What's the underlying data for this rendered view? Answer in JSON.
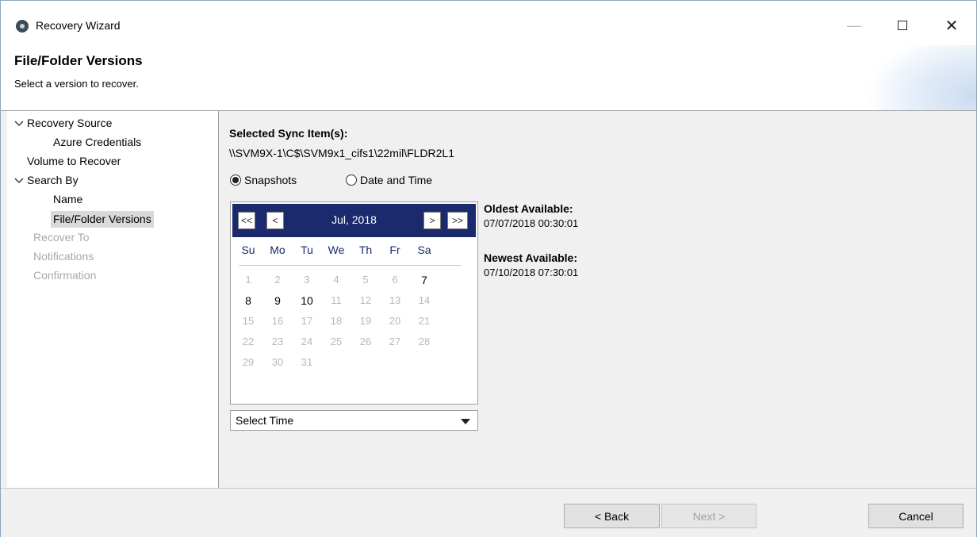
{
  "window": {
    "title": "Recovery Wizard",
    "close_glyph": "✕",
    "minimize_glyph": "—"
  },
  "header": {
    "title": "File/Folder Versions",
    "subtitle": "Select a version to recover."
  },
  "nav": {
    "items": [
      {
        "label": "Recovery Source",
        "state": "normal",
        "expandable": true
      },
      {
        "label": "Azure Credentials",
        "state": "normal"
      },
      {
        "label": "Volume to Recover",
        "state": "normal"
      },
      {
        "label": "Search By",
        "state": "normal",
        "expandable": true
      },
      {
        "label": "Name",
        "state": "normal"
      },
      {
        "label": "File/Folder Versions",
        "state": "selected"
      },
      {
        "label": "Recover To",
        "state": "disabled"
      },
      {
        "label": "Notifications",
        "state": "disabled"
      },
      {
        "label": "Confirmation",
        "state": "disabled"
      }
    ],
    "expand_glyph": "✓"
  },
  "content": {
    "selected_label": "Selected Sync Item(s):",
    "selected_path": "\\\\SVM9X-1\\C$\\SVM9x1_cifs1\\22mil\\FLDR2L1",
    "mode_options": [
      {
        "label": "Snapshots",
        "checked": true
      },
      {
        "label": "Date and Time",
        "checked": false
      }
    ],
    "calendar": {
      "month": "Jul, 2018",
      "nav": {
        "first": "<<",
        "prev": "<",
        "next": ">",
        "last": ">>"
      },
      "weekdays": [
        "Su",
        "Mo",
        "Tu",
        "We",
        "Th",
        "Fr",
        "Sa"
      ],
      "weeks": [
        [
          "1",
          "2",
          "3",
          "4",
          "5",
          "6",
          "7"
        ],
        [
          "8",
          "9",
          "10",
          "11",
          "12",
          "13",
          "14"
        ],
        [
          "15",
          "16",
          "17",
          "18",
          "19",
          "20",
          "21"
        ],
        [
          "22",
          "23",
          "24",
          "25",
          "26",
          "27",
          "28"
        ],
        [
          "29",
          "30",
          "31"
        ]
      ],
      "available_days": [
        "7",
        "8",
        "9",
        "10"
      ]
    },
    "select_time": {
      "value": "Select Time"
    },
    "oldest_label": "Oldest Available:",
    "oldest_value": "07/07/2018 00:30:01",
    "newest_label": "Newest Available:",
    "newest_value": "07/10/2018 07:30:01"
  },
  "footer": {
    "back": "< Back",
    "next": "Next >",
    "cancel": "Cancel"
  }
}
